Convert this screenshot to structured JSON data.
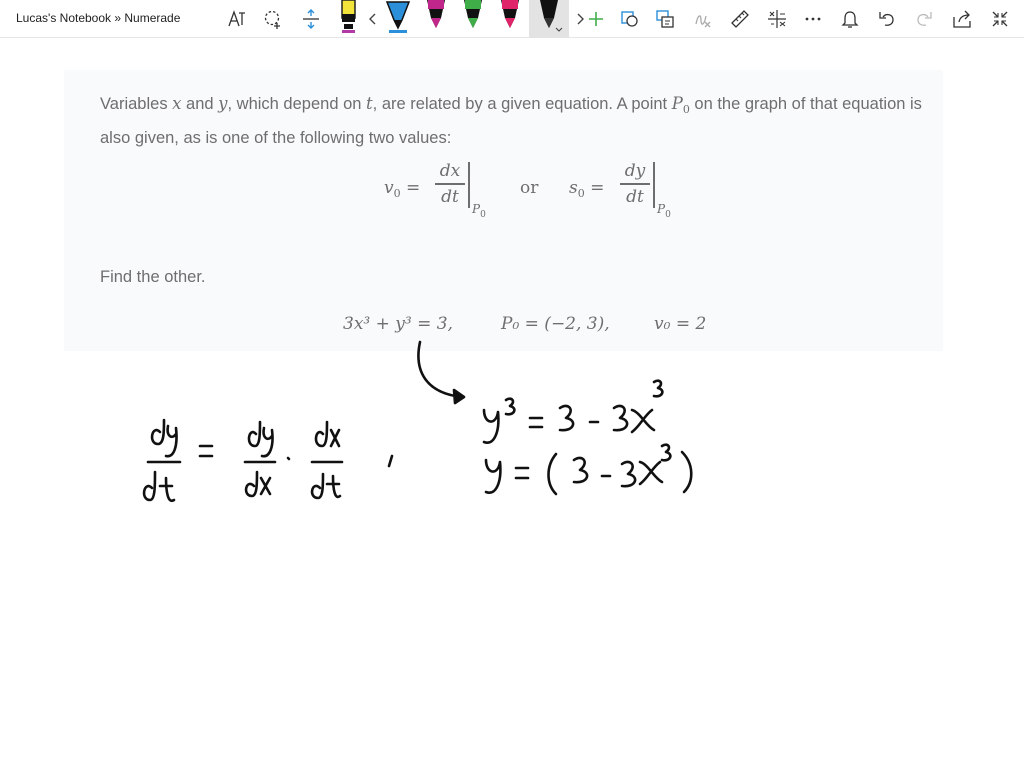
{
  "window": {
    "title": "Lucas's Notebook » Numerade"
  },
  "toolbar": {
    "tools": [
      {
        "name": "lasso-text-select",
        "icon": "lasso-text-icon"
      },
      {
        "name": "lasso-select",
        "icon": "lasso-select-icon"
      },
      {
        "name": "insert-space",
        "icon": "insert-space-icon"
      },
      {
        "name": "highlighter-yellow",
        "icon": "pen-icon",
        "color": "#f2e33a"
      },
      {
        "name": "pens-scroll-left",
        "icon": "chevron-left-icon"
      },
      {
        "name": "pen-blue",
        "icon": "pen-icon",
        "color": "#2b8fd9"
      },
      {
        "name": "pen-magenta",
        "icon": "pen-icon",
        "color": "#c1278a"
      },
      {
        "name": "pen-green",
        "icon": "pen-icon",
        "color": "#3fae49"
      },
      {
        "name": "pen-pink",
        "icon": "pen-icon",
        "color": "#e0246a"
      },
      {
        "name": "pen-black",
        "icon": "pen-icon",
        "color": "#111111",
        "selected": true
      },
      {
        "name": "pens-scroll-right",
        "icon": "chevron-right-icon"
      },
      {
        "name": "add-pen",
        "icon": "plus-icon"
      },
      {
        "name": "ink-to-shape",
        "icon": "ink-to-shape-icon"
      },
      {
        "name": "ink-to-text",
        "icon": "ink-to-text-icon"
      },
      {
        "name": "ink-to-math",
        "icon": "ink-to-math-icon"
      },
      {
        "name": "ruler",
        "icon": "ruler-icon"
      },
      {
        "name": "math",
        "icon": "math-icon"
      },
      {
        "name": "more",
        "icon": "ellipsis-icon"
      },
      {
        "name": "notifications",
        "icon": "bell-icon"
      },
      {
        "name": "undo",
        "icon": "undo-icon"
      },
      {
        "name": "redo",
        "icon": "redo-icon"
      },
      {
        "name": "share",
        "icon": "share-icon"
      },
      {
        "name": "fullscreen",
        "icon": "expand-icon"
      }
    ]
  },
  "problem": {
    "intro_before_x": "Variables ",
    "var_x": "x",
    "and": " and ",
    "var_y": "y",
    "depend_text": ", which depend on ",
    "var_t": "t",
    "related_text": ", are related by a given equation. A point ",
    "point_name": "P",
    "point_sub": "0",
    "rest_text": " on the graph of that equation is also given, as is one of the following two values:",
    "v0_lhs": "v",
    "v0_sub": "0",
    "equals": "=",
    "v0_num": "dx",
    "v0_den": "dt",
    "eval_point": "P",
    "eval_sub": "0",
    "or": "or",
    "s0_lhs": "s",
    "s0_sub": "0",
    "s0_num": "dy",
    "s0_den": "dt",
    "find": "Find the other.",
    "given_equation": "3x³ + y³ = 3,",
    "given_point": "P₀ = (−2, 3),",
    "given_value": "v₀ = 2"
  },
  "ink_color": "#111111"
}
